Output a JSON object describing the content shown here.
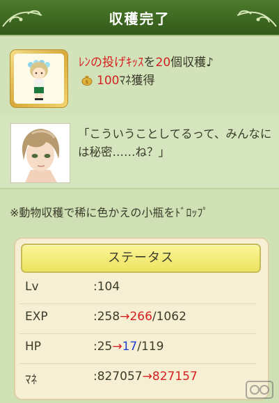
{
  "header": {
    "title": "収穫完了"
  },
  "reward": {
    "item_name": "ﾚﾝの投げｷｯｽ",
    "line1_mid": "を",
    "count": "20",
    "line1_suffix": "個収穫♪",
    "money_amount": "100",
    "money_suffix": "ﾏﾈ獲得"
  },
  "dialogue": {
    "text": "「こういうことしてるって、みんなには秘密……ね？」"
  },
  "note": {
    "text": "※動物収穫で稀に色かえの小瓶をﾄﾞﾛｯﾌﾟ"
  },
  "status": {
    "button_label": "ステータス",
    "rows": [
      {
        "label": "Lv",
        "prefix": ":104"
      },
      {
        "label": "EXP",
        "prefix": ":258",
        "arrow": "→",
        "new": "266",
        "suffix": "/1062"
      },
      {
        "label": "HP",
        "prefix": ":25",
        "arrow": "→",
        "new": "17",
        "suffix": "/119"
      },
      {
        "label": "ﾏﾈ",
        "prefix": ":827057",
        "arrow": "→",
        "new": "827157"
      }
    ]
  },
  "colors": {
    "header_green": "#3c6620",
    "accent_red": "#d52020",
    "accent_blue": "#1f3fd0",
    "status_button_yellow": "#ece35f"
  }
}
